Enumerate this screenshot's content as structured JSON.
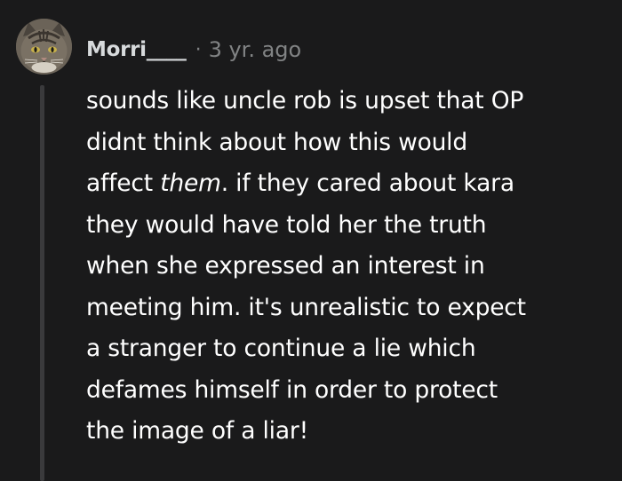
{
  "comment": {
    "author": "Morri____",
    "separator": "·",
    "timestamp": "3 yr. ago",
    "avatar_icon": "cat-avatar-icon",
    "body_lines": [
      {
        "pre": "sounds like uncle rob is upset that OP",
        "em": "",
        "post": ""
      },
      {
        "pre": "didnt think about how this would",
        "em": "",
        "post": ""
      },
      {
        "pre": "affect ",
        "em": "them",
        "post": ". if they cared about kara"
      },
      {
        "pre": "they would have told her the truth",
        "em": "",
        "post": ""
      },
      {
        "pre": "when she expressed an interest in",
        "em": "",
        "post": ""
      },
      {
        "pre": "meeting him. it's unrealistic to expect",
        "em": "",
        "post": ""
      },
      {
        "pre": "a stranger to continue a lie which",
        "em": "",
        "post": ""
      },
      {
        "pre": "defames himself in order to protect",
        "em": "",
        "post": ""
      },
      {
        "pre": "the image of a liar!",
        "em": "",
        "post": ""
      }
    ]
  },
  "colors": {
    "background": "#1a1a1b",
    "username": "#d7dadc",
    "muted": "#818384",
    "body": "#ffffff",
    "thread_line": "#3a3a3c"
  }
}
